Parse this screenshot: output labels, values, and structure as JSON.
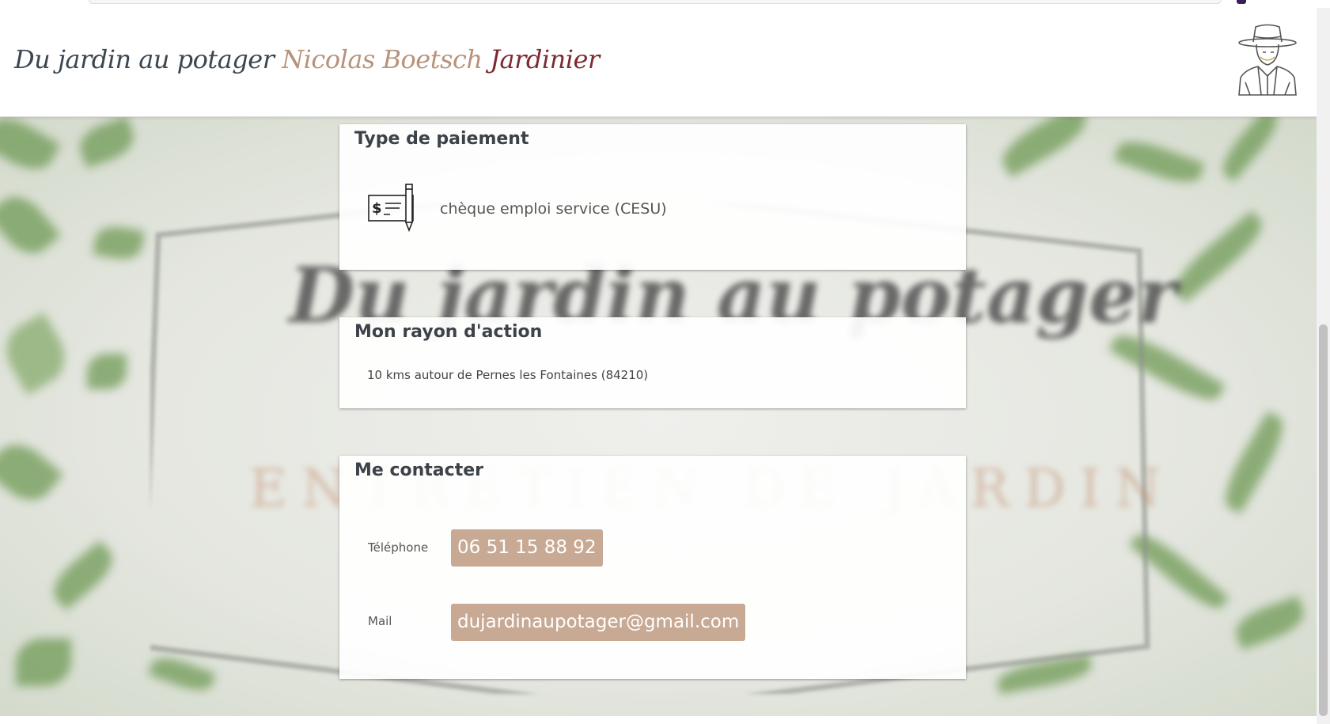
{
  "header": {
    "brand_part1": "Du jardin au potager",
    "brand_part2": "Nicolas Boetsch",
    "brand_part3": "Jardinier"
  },
  "payment": {
    "title": "Type de paiement",
    "method": "chèque emploi service (CESU)"
  },
  "area": {
    "title": "Mon rayon d'action",
    "text": "10 kms autour de Pernes les Fontaines (84210)"
  },
  "contact": {
    "title": "Me contacter",
    "phone_label": "Téléphone",
    "phone": "06 51 15 88 92",
    "mail_label": "Mail",
    "mail": "dujardinaupotager@gmail.com"
  },
  "colors": {
    "accent": "#c8a994",
    "brand_dark": "#3c4650",
    "brand_tan": "#b8927a",
    "brand_red": "#7d2a32"
  }
}
